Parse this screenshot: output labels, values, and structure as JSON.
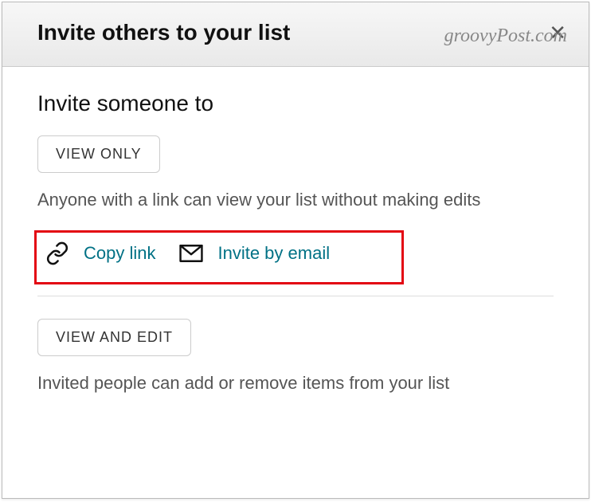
{
  "watermark": "groovyPost.com",
  "header": {
    "title": "Invite others to your list"
  },
  "body": {
    "section_title": "Invite someone to",
    "view_only": {
      "button_label": "VIEW ONLY",
      "description": "Anyone with a link can view your list without making edits",
      "actions": {
        "copy_link": "Copy link",
        "invite_email": "Invite by email"
      }
    },
    "view_edit": {
      "button_label": "VIEW AND EDIT",
      "description": "Invited people can add or remove items from your list"
    }
  }
}
